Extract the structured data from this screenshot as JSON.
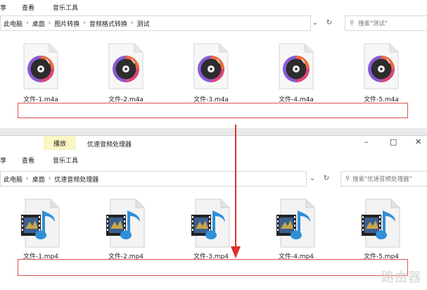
{
  "window_top": {
    "ribbon_tabs": [
      "享",
      "查看",
      "音乐工具"
    ],
    "breadcrumb": [
      "此电脑",
      "桌面",
      "图片转换",
      "音频格式转换",
      "测试"
    ],
    "search_placeholder": "搜索\"测试\"",
    "files": [
      "文件-1.m4a",
      "文件-2.m4a",
      "文件-3.m4a",
      "文件-4.m4a",
      "文件-5.m4a"
    ],
    "icon": "music-disc-icon"
  },
  "window_bottom": {
    "context_tab": "播放",
    "title": "优速音频处理器",
    "ribbon_tabs": [
      "享",
      "查看",
      "音乐工具"
    ],
    "breadcrumb": [
      "此电脑",
      "桌面",
      "优速音频处理器"
    ],
    "search_placeholder": "搜索\"优速音频处理器\"",
    "files": [
      "文件-1.mp4",
      "文件-2.mp4",
      "文件-3.mp4",
      "文件-4.mp4",
      "文件-5.mp4"
    ],
    "icon": "video-music-file-icon",
    "window_controls": [
      "–",
      "□",
      "✕"
    ]
  },
  "colors": {
    "selection_border": "#d9534f",
    "arrow": "#d9342b",
    "context_tab_bg": "#fbf7c4"
  },
  "watermark": "路由器"
}
